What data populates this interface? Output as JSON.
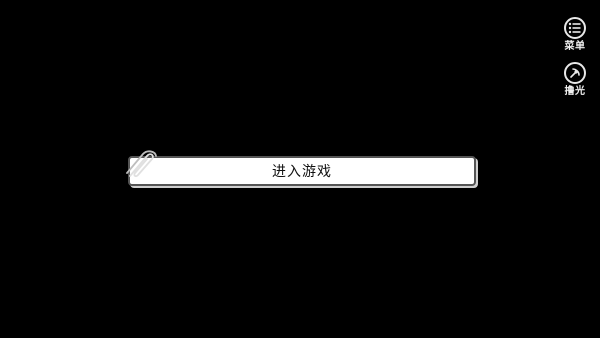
{
  "side_buttons": {
    "menu": {
      "label": "菜单",
      "icon": "list-icon"
    },
    "skip": {
      "label": "撸光",
      "icon": "skip-icon"
    }
  },
  "choices": [
    {
      "text": "进入游戏"
    }
  ],
  "colors": {
    "background": "#000000",
    "bar_fill": "#ffffff",
    "icon_stroke": "#e8e8e8"
  }
}
